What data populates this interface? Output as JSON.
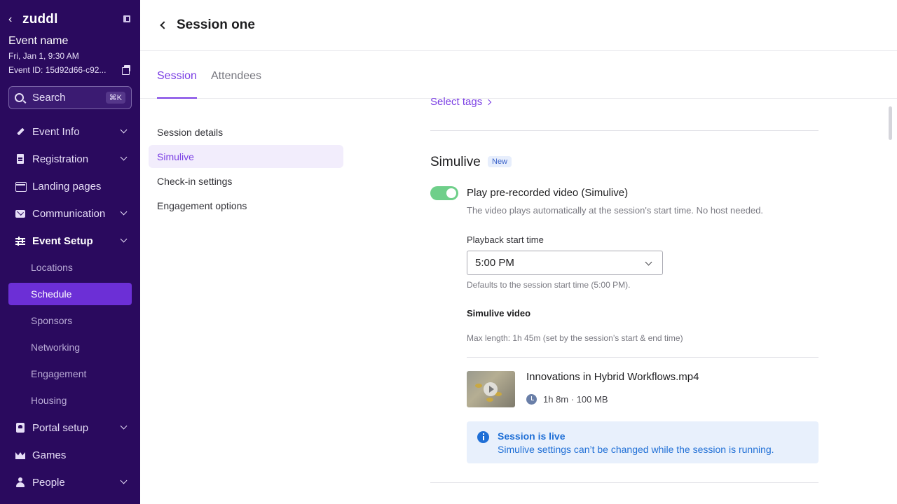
{
  "sidebar": {
    "brand": "zuddl",
    "event_name": "Event name",
    "event_date": "Fri, Jan 1, 9:30 AM",
    "event_id": "Event ID: 15d92d66-c92...",
    "search_label": "Search",
    "search_shortcut": "⌘K",
    "nav": [
      {
        "label": "Event Info",
        "icon": "pen-icon"
      },
      {
        "label": "Registration",
        "icon": "doc-icon"
      },
      {
        "label": "Landing pages",
        "icon": "page-icon"
      },
      {
        "label": "Communication",
        "icon": "mail-icon"
      },
      {
        "label": "Event Setup",
        "icon": "sliders-icon"
      },
      {
        "label": "Portal setup",
        "icon": "portal-icon"
      },
      {
        "label": "Games",
        "icon": "crown-icon"
      },
      {
        "label": "People",
        "icon": "person-icon"
      }
    ],
    "sub": [
      "Locations",
      "Schedule",
      "Sponsors",
      "Networking",
      "Engagement",
      "Housing"
    ],
    "active_sub": "Schedule"
  },
  "header": {
    "title": "Session one"
  },
  "tabs": [
    {
      "label": "Session"
    },
    {
      "label": "Attendees"
    }
  ],
  "subnav": [
    "Session details",
    "Simulive",
    "Check-in settings",
    "Engagement options"
  ],
  "content": {
    "select_tags": "Select tags",
    "section_title": "Simulive",
    "badge": "New",
    "toggle_label": "Play pre-recorded video (Simulive)",
    "toggle_desc": "The video plays automatically at the session's start time. No host needed.",
    "playback_label": "Playback start time",
    "playback_value": "5:00 PM",
    "playback_hint": "Defaults to the session start time (5:00 PM).",
    "video_heading": "Simulive video",
    "video_max": "Max length: 1h 45m (set by the session’s start & end time)",
    "video_name": "Innovations in Hybrid Workflows.mp4",
    "video_meta": "1h 8m · 100 MB",
    "alert_title": "Session is live",
    "alert_body": "Simulive settings can’t be changed while the session is running."
  },
  "colors": {
    "sidebar_bg": "#2a0a5e",
    "accent": "#7b3fe4",
    "toggle_on": "#6fcf8a",
    "info": "#1f6fd6"
  }
}
